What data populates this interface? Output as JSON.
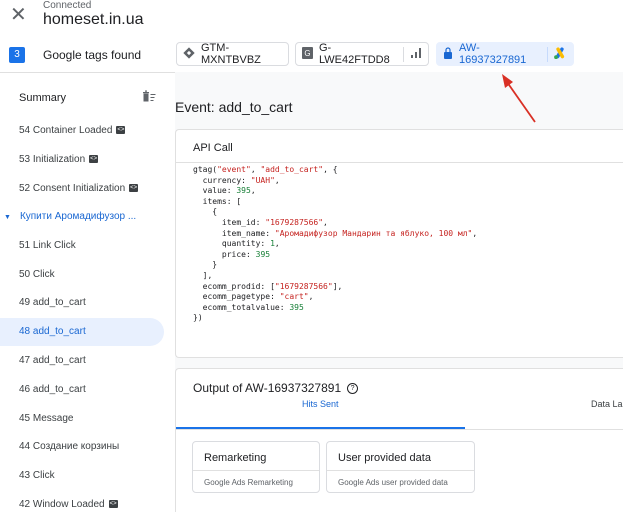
{
  "header": {
    "status": "Connected",
    "domain": "homeset.in.ua"
  },
  "tagsbar": {
    "count": "3",
    "label": "Google tags found",
    "tags": [
      {
        "id": "GTM-MXNTBVBZ",
        "icon": "gtm-icon"
      },
      {
        "id": "G-LWE42FTDD8",
        "icon": "ga4-icon"
      },
      {
        "id": "AW-16937327891",
        "icon": "google-ads-icon"
      }
    ]
  },
  "sidebar": {
    "summary_label": "Summary",
    "events": [
      {
        "label": "54 Container Loaded",
        "code_icon": true
      },
      {
        "label": "53 Initialization",
        "code_icon": true
      },
      {
        "label": "52 Consent Initialization",
        "code_icon": true
      },
      {
        "label": "Купити Аромадифузор ...",
        "group": true
      },
      {
        "label": "51 Link Click"
      },
      {
        "label": "50 Click"
      },
      {
        "label": "49 add_to_cart"
      },
      {
        "label": "48 add_to_cart",
        "selected": true
      },
      {
        "label": "47 add_to_cart"
      },
      {
        "label": "46 add_to_cart"
      },
      {
        "label": "45 Message"
      },
      {
        "label": "44 Создание корзины"
      },
      {
        "label": "43 Click"
      },
      {
        "label": "42 Window Loaded",
        "code_icon": true
      }
    ]
  },
  "main": {
    "title": "Event: add_to_cart",
    "api_call": {
      "title": "API Call",
      "code": [
        [
          [
            "p",
            "gtag("
          ],
          [
            "s",
            "\"event\""
          ],
          [
            "p",
            ", "
          ],
          [
            "s",
            "\"add_to_cart\""
          ],
          [
            "p",
            ", {"
          ]
        ],
        [
          [
            "p",
            "  currency: "
          ],
          [
            "s",
            "\"UAH\""
          ],
          [
            "p",
            ","
          ]
        ],
        [
          [
            "p",
            "  value: "
          ],
          [
            "n",
            "395"
          ],
          [
            "p",
            ","
          ]
        ],
        [
          [
            "p",
            "  items: ["
          ]
        ],
        [
          [
            "p",
            "    {"
          ]
        ],
        [
          [
            "p",
            "      item_id: "
          ],
          [
            "s",
            "\"1679287566\""
          ],
          [
            "p",
            ","
          ]
        ],
        [
          [
            "p",
            "      item_name: "
          ],
          [
            "s",
            "\"Аромадифузор Мандарин та яблуко, 100 мл\""
          ],
          [
            "p",
            ","
          ]
        ],
        [
          [
            "p",
            "      quantity: "
          ],
          [
            "n",
            "1"
          ],
          [
            "p",
            ","
          ]
        ],
        [
          [
            "p",
            "      price: "
          ],
          [
            "n",
            "395"
          ]
        ],
        [
          [
            "p",
            "    }"
          ]
        ],
        [
          [
            "p",
            "  ],"
          ]
        ],
        [
          [
            "p",
            "  ecomm_prodid: ["
          ],
          [
            "s",
            "\"1679287566\""
          ],
          [
            "p",
            "],"
          ]
        ],
        [
          [
            "p",
            "  ecomm_pagetype: "
          ],
          [
            "s",
            "\"cart\""
          ],
          [
            "p",
            ","
          ]
        ],
        [
          [
            "p",
            "  ecomm_totalvalue: "
          ],
          [
            "n",
            "395"
          ]
        ],
        [
          [
            "p",
            "})"
          ]
        ]
      ]
    },
    "output": {
      "title": "Output of AW-16937327891",
      "tabs": [
        "Hits Sent",
        "Data La"
      ],
      "hits": [
        {
          "title": "Remarketing",
          "sub": "Google Ads Remarketing"
        },
        {
          "title": "User provided data",
          "sub": "Google Ads user provided data"
        }
      ]
    }
  },
  "colors": {
    "accent": "#1a73e8",
    "selected_bg": "#e8f0fe",
    "arrow": "#d93025"
  }
}
